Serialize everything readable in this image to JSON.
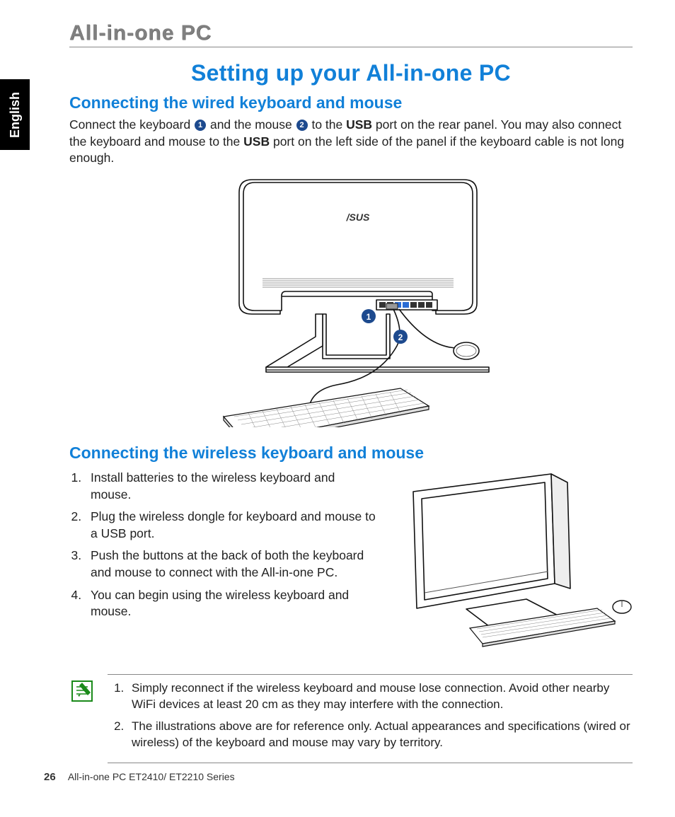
{
  "lang_tab": "English",
  "header": "All-in-one PC",
  "title": "Setting up your All-in-one PC",
  "section1": {
    "heading": "Connecting the wired keyboard and mouse",
    "para_parts": {
      "p1": "Connect the keyboard ",
      "badge1": "1",
      "p2": " and the mouse ",
      "badge2": "2",
      "p3": " to the ",
      "bold1": "USB",
      "p4": " port on the rear panel. You may also connect the keyboard and mouse to the ",
      "bold2": "USB",
      "p5": " port on the left side of the panel if the keyboard cable is not long enough."
    }
  },
  "section2": {
    "heading": "Connecting the wireless keyboard and mouse",
    "steps": [
      "Install batteries to the wireless keyboard and mouse.",
      "Plug the wireless dongle for keyboard and mouse to a USB port.",
      "Push the buttons at the back of both the keyboard and mouse to connect with the All-in-one PC.",
      "You can begin using the wireless keyboard and mouse."
    ]
  },
  "notes": [
    "Simply reconnect if the wireless keyboard and mouse lose connection.  Avoid other nearby WiFi devices at least 20 cm as they may interfere with the connection.",
    "The illustrations above are for reference only. Actual appearances and specifications (wired or wireless) of the keyboard and mouse may vary by territory."
  ],
  "footer": {
    "page": "26",
    "series": "All-in-one PC ET2410/ ET2210 Series"
  }
}
